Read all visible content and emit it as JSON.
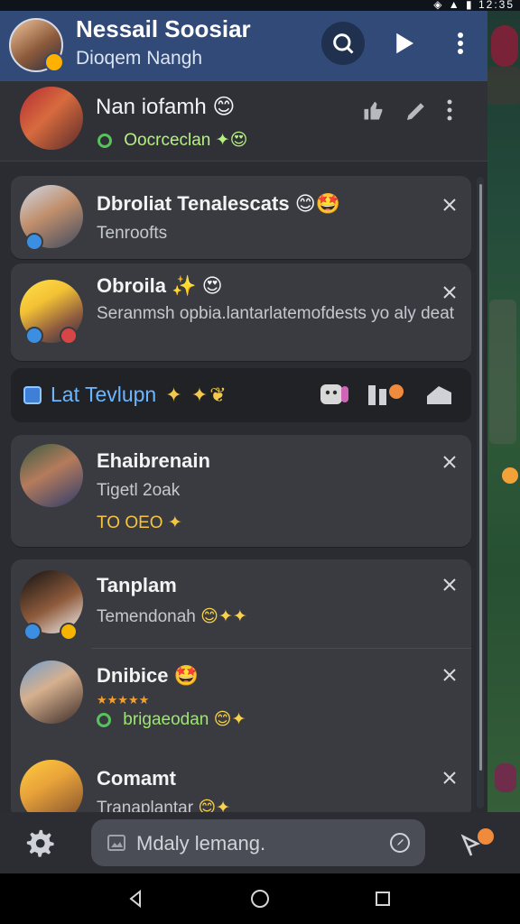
{
  "status": {
    "icons": [
      "wifi-icon",
      "signal-icon",
      "battery-icon"
    ],
    "time": "12:35"
  },
  "header": {
    "title": "Nessail Soosiar",
    "subtitle": "Dioqem Nangh",
    "actions": {
      "search": "search-icon",
      "send": "send-icon",
      "menu": "more-icon"
    }
  },
  "top": {
    "name": "Nan iofamh",
    "status": "Oocrceclan",
    "emoji_name": "😊",
    "emoji_status": "✦😍"
  },
  "cards": [
    {
      "name": "Dbroliat Tenalescats",
      "name_emoji": "😊🤩",
      "sub": "Tenroofts"
    },
    {
      "name": "Obroila",
      "name_emoji": "✨ 😍",
      "sub": "Seranmsh opbia.lantarlatemofdests yo aly deat"
    },
    {
      "name": "Ehaibrenain",
      "sub": "Tigetl 2oak",
      "meta": "TO OEO",
      "meta_emoji": "✦"
    },
    {
      "name": "Tanplam",
      "sub": "Temendonah",
      "sub_emoji": "😊✦✦"
    },
    {
      "name": "Dnibice",
      "name_emoji": "🤩",
      "rating": "★★★★★",
      "sub": "brigaeodan",
      "sub_emoji": "😊✦"
    },
    {
      "name": "Comamt",
      "sub": "Tranaplantar",
      "sub_emoji": "😊✦"
    }
  ],
  "pinned": {
    "label": "Lat Tevlupn",
    "extra": "✦ ✦❦",
    "right_icons": [
      "sticker-icon",
      "shield-icon",
      "home-icon"
    ]
  },
  "bottom": {
    "placeholder": "Mdaly lemang.",
    "left_icon": "image-icon",
    "right_icon": "compass-icon"
  }
}
